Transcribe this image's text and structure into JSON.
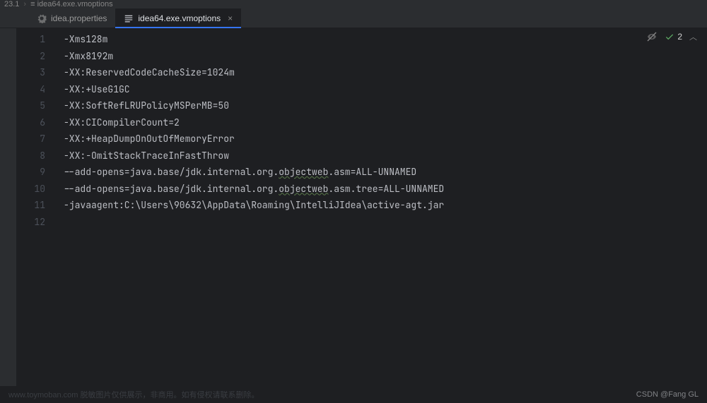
{
  "breadcrumb": {
    "root": "23.1",
    "file": "idea64.exe.vmoptions"
  },
  "tabs": [
    {
      "label": "idea.properties",
      "active": false,
      "closable": false
    },
    {
      "label": "idea64.exe.vmoptions",
      "active": true,
      "closable": true
    }
  ],
  "indicators": {
    "problem_count": "2"
  },
  "editor": {
    "lines": [
      "-Xms128m",
      "-Xmx8192m",
      "-XX:ReservedCodeCacheSize=1024m",
      "-XX:+UseG1GC",
      "-XX:SoftRefLRUPolicyMSPerMB=50",
      "-XX:CICompilerCount=2",
      "-XX:+HeapDumpOnOutOfMemoryError",
      "-XX:-OmitStackTraceInFastThrow",
      "--add-opens=java.base/jdk.internal.org.objectweb.asm=ALL-UNNAMED",
      "--add-opens=java.base/jdk.internal.org.objectweb.asm.tree=ALL-UNNAMED",
      "-javaagent:C:\\Users\\90632\\AppData\\Roaming\\IntelliJIdea\\active-agt.jar",
      ""
    ],
    "highlighted_word": "objectweb",
    "total_lines": 12
  },
  "watermark": {
    "left": "www.toymoban.com 脱敏图片仅供展示，非商用。如有侵权请联系删除。",
    "right": "CSDN @Fang GL"
  }
}
